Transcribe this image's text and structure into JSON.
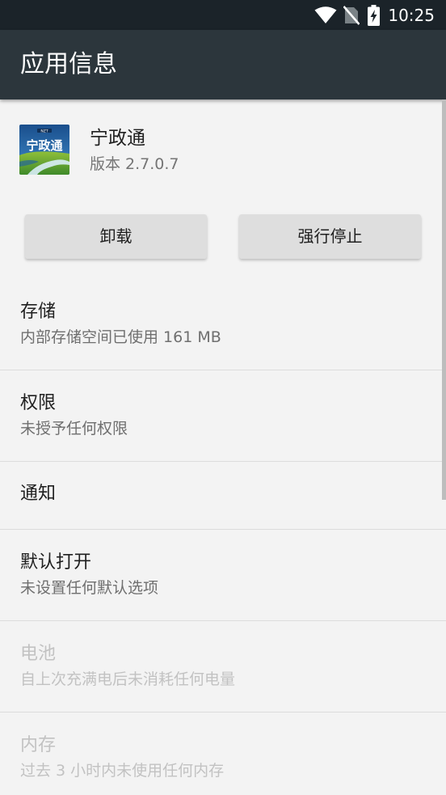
{
  "status_bar": {
    "time": "10:25"
  },
  "app_bar": {
    "title": "应用信息"
  },
  "app": {
    "name": "宁政通",
    "version": "版本 2.7.0.7",
    "icon_text": "宁政通",
    "icon_small_text": "NZT"
  },
  "buttons": {
    "uninstall": "卸载",
    "force_stop": "强行停止"
  },
  "items": [
    {
      "title": "存储",
      "subtitle": "内部存储空间已使用 161 MB",
      "enabled": true
    },
    {
      "title": "权限",
      "subtitle": "未授予任何权限",
      "enabled": true
    },
    {
      "title": "通知",
      "subtitle": "",
      "enabled": true
    },
    {
      "title": "默认打开",
      "subtitle": "未设置任何默认选项",
      "enabled": true
    },
    {
      "title": "电池",
      "subtitle": "自上次充满电后未消耗任何电量",
      "enabled": false
    },
    {
      "title": "内存",
      "subtitle": "过去 3 小时内未使用任何内存",
      "enabled": false
    }
  ],
  "colors": {
    "status_bar": "#1b2329",
    "app_bar": "#2c363c",
    "background": "#f3f3f3",
    "button": "#dedede"
  },
  "icons": [
    "wifi-icon",
    "no-sim-icon",
    "battery-charging-icon"
  ]
}
